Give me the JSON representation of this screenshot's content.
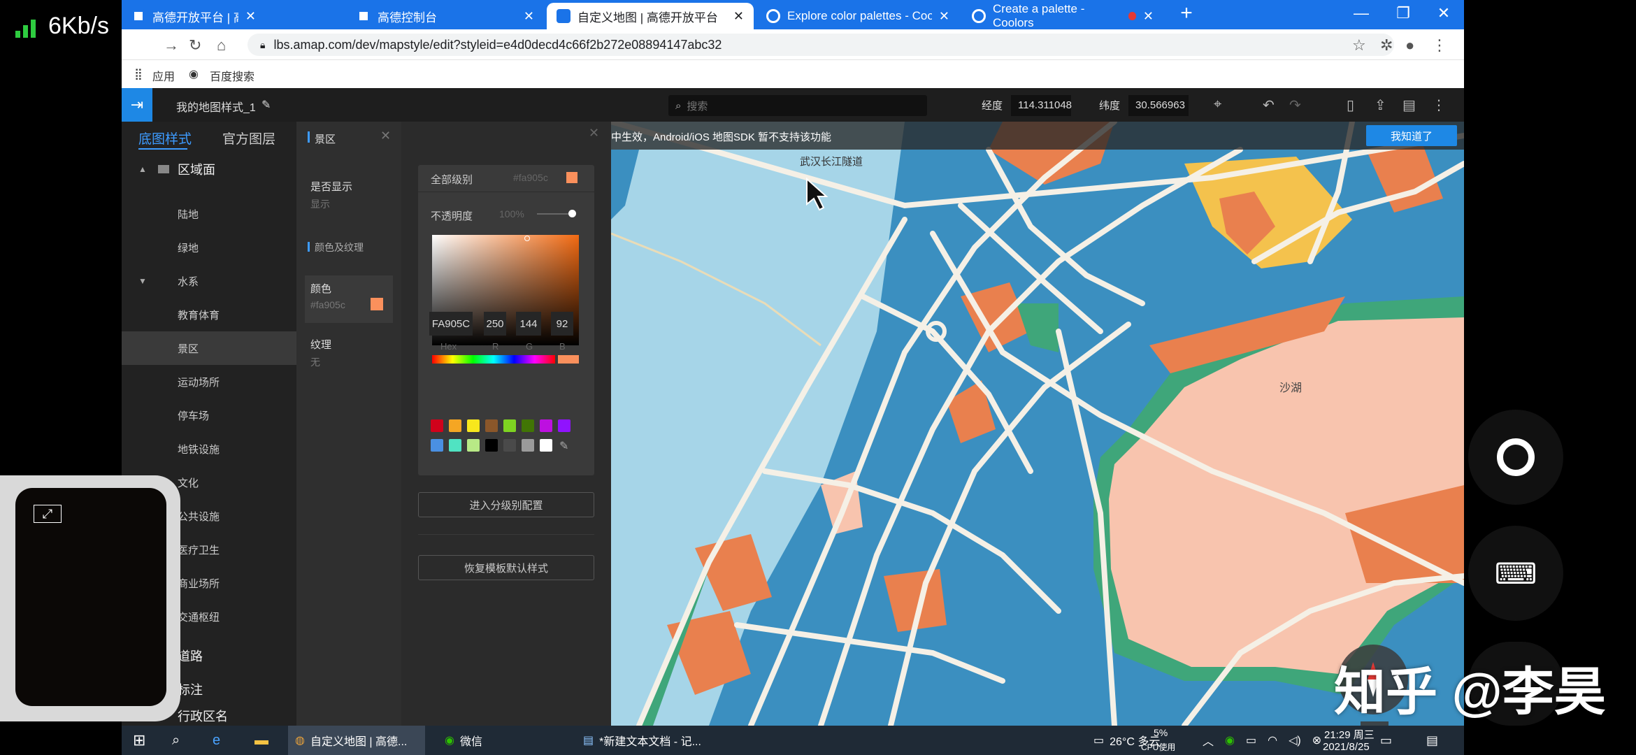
{
  "status": {
    "net_speed": "6Kb/s"
  },
  "browser": {
    "tabs": [
      {
        "title": "高德开放平台 | 高德地图API",
        "active": false
      },
      {
        "title": "高德控制台",
        "active": false
      },
      {
        "title": "自定义地图 | 高德开放平台",
        "active": true
      },
      {
        "title": "Explore color palettes - Coolors",
        "active": false
      },
      {
        "title": "Create a palette - Coolors",
        "active": false
      }
    ],
    "url": "lbs.amap.com/dev/mapstyle/edit?styleid=e4d0decd4c66f2b272e08894147abc32",
    "bookmarks": [
      "应用",
      "百度搜索"
    ]
  },
  "editor": {
    "style_name": "我的地图样式_1",
    "search_placeholder": "搜索",
    "lng_label": "经度",
    "lng_value": "114.311048",
    "lat_label": "纬度",
    "lat_value": "30.566963",
    "left_tabs": [
      "底图样式",
      "官方图层"
    ],
    "left_items": [
      {
        "label": "区域面",
        "group": true,
        "arrow": "▲"
      },
      {
        "label": "陆地"
      },
      {
        "label": "绿地"
      },
      {
        "label": "水系",
        "arrow": "▼"
      },
      {
        "label": "教育体育"
      },
      {
        "label": "景区",
        "selected": true
      },
      {
        "label": "运动场所"
      },
      {
        "label": "停车场"
      },
      {
        "label": "地铁设施"
      },
      {
        "label": "文化"
      },
      {
        "label": "公共设施"
      },
      {
        "label": "医疗卫生"
      },
      {
        "label": "商业场所"
      },
      {
        "label": "交通枢纽"
      },
      {
        "label": "道路",
        "group": true
      },
      {
        "label": "标注",
        "group": true
      },
      {
        "label": "行政区名",
        "group": true
      }
    ],
    "mid": {
      "title": "景区",
      "visible_label": "是否显示",
      "visible_value": "显示",
      "section": "颜色及纹理",
      "color_label": "颜色",
      "color_value": "#fa905c",
      "texture_label": "纹理",
      "texture_value": "无"
    },
    "picker": {
      "level_label": "全部级别",
      "level_color": "#fa905c",
      "opacity_label": "不透明度",
      "opacity_value": "100%",
      "hex": "FA905C",
      "r": "250",
      "g": "144",
      "b": "92",
      "labels": [
        "Hex",
        "R",
        "G",
        "B"
      ],
      "swatches_row1": [
        "#d0021b",
        "#f5a623",
        "#f8e71c",
        "#8b572a",
        "#7ed321",
        "#417505",
        "#bd10e0",
        "#9013fe"
      ],
      "swatches_row2": [
        "#4a90e2",
        "#50e3c2",
        "#b8e986",
        "#000000",
        "#4a4a4a",
        "#9b9b9b",
        "#ffffff"
      ]
    },
    "btn_level": "进入分级别配置",
    "btn_reset": "恢复模板默认样式"
  },
  "map": {
    "notice": "中生效，Android/iOS 地图SDK 暂不支持该功能",
    "ok_label": "我知道了",
    "label_tunnel": "武汉长江隧道",
    "label_lake": "沙湖",
    "colors": {
      "water": "#a6d5e8",
      "block": "#3b8fc0",
      "road": "#f5f0e6",
      "orange": "#e9804e",
      "green": "#3fa67a",
      "yellow": "#f4c24d",
      "pink": "#f8c4ae"
    }
  },
  "taskbar": {
    "items": [
      "自定义地图 | 高德...",
      "微信",
      "*新建文本文档 - 记..."
    ],
    "weather": "26°C 多云",
    "cpu": "5%",
    "cpu_label": "CPU使用",
    "time": "21:29 周三",
    "date": "2021/8/25"
  },
  "watermark": "知乎 @李昊"
}
